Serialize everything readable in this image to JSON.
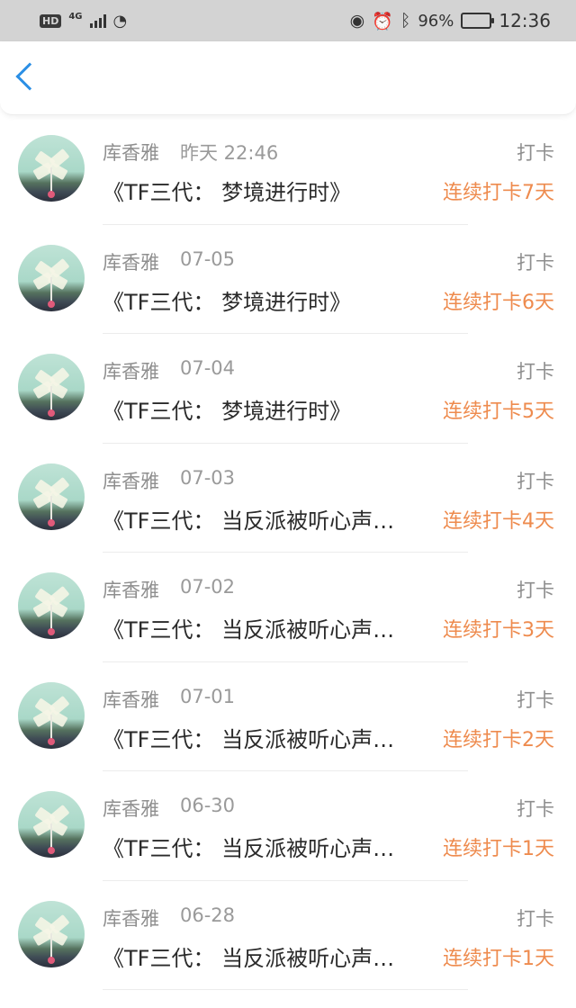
{
  "status_bar": {
    "hd": "HD",
    "network": "4G",
    "battery": "96%",
    "battery_level": 0.96,
    "time": "12:36",
    "icons": [
      "signal-icon",
      "wifi-icon",
      "eye-icon",
      "alarm-icon",
      "bluetooth-icon",
      "leaf-icon",
      "battery-icon"
    ]
  },
  "nav": {
    "back_icon": "chevron-left-icon",
    "accent": "#2b8fe5"
  },
  "colors": {
    "streak": "#ee8b4e",
    "meta": "#8e8e8e"
  },
  "items": [
    {
      "name": "库香雅",
      "date": "昨天 22:46",
      "title": "《TF三代： 梦境进行时》",
      "tag": "打卡",
      "streak": "连续打卡7天"
    },
    {
      "name": "库香雅",
      "date": "07-05",
      "title": "《TF三代： 梦境进行时》",
      "tag": "打卡",
      "streak": "连续打卡6天"
    },
    {
      "name": "库香雅",
      "date": "07-04",
      "title": "《TF三代： 梦境进行时》",
      "tag": "打卡",
      "streak": "连续打卡5天"
    },
    {
      "name": "库香雅",
      "date": "07-03",
      "title": "《TF三代： 当反派被听心声…",
      "tag": "打卡",
      "streak": "连续打卡4天"
    },
    {
      "name": "库香雅",
      "date": "07-02",
      "title": "《TF三代： 当反派被听心声…",
      "tag": "打卡",
      "streak": "连续打卡3天"
    },
    {
      "name": "库香雅",
      "date": "07-01",
      "title": "《TF三代： 当反派被听心声…",
      "tag": "打卡",
      "streak": "连续打卡2天"
    },
    {
      "name": "库香雅",
      "date": "06-30",
      "title": "《TF三代： 当反派被听心声…",
      "tag": "打卡",
      "streak": "连续打卡1天"
    },
    {
      "name": "库香雅",
      "date": "06-28",
      "title": "《TF三代： 当反派被听心声…",
      "tag": "打卡",
      "streak": "连续打卡1天"
    }
  ]
}
